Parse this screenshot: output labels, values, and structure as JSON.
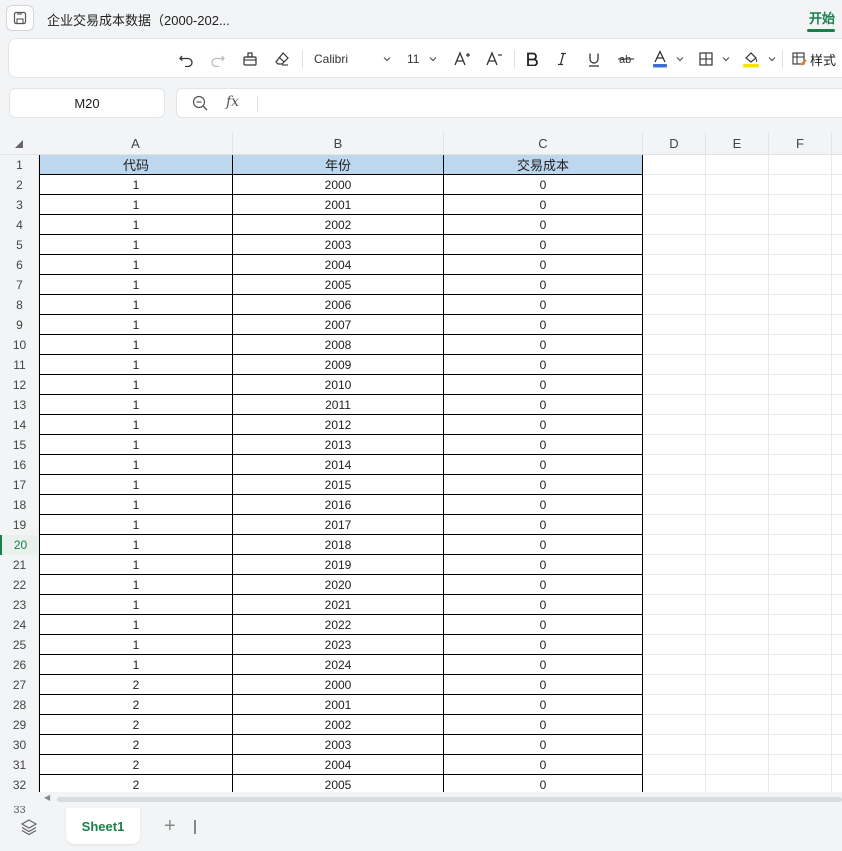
{
  "app": {
    "doc_title": "企业交易成本数据（2000-202...",
    "tab_active": "开始"
  },
  "toolbar": {
    "font_name": "Calibri",
    "font_size": "11",
    "style_label": "样式",
    "font_color": "#3b6fd8",
    "fill_color": "#f5e400",
    "icons": [
      "undo-icon",
      "redo-icon",
      "format-painter-icon",
      "clear-icon",
      "increase-font-icon",
      "decrease-font-icon",
      "bold-icon",
      "italic-icon",
      "underline-icon",
      "strikethrough-icon",
      "font-color-icon",
      "border-icon",
      "fill-color-icon",
      "styles-icon"
    ]
  },
  "formula": {
    "cell_ref": "M20",
    "fx_label": "fx",
    "value": ""
  },
  "grid": {
    "columns": [
      "A",
      "B",
      "C",
      "D",
      "E",
      "F"
    ],
    "active_row": 20,
    "header_fill": "#bdd7ee",
    "header": [
      "代码",
      "年份",
      "交易成本"
    ],
    "rows": [
      [
        "1",
        "2000",
        "0"
      ],
      [
        "1",
        "2001",
        "0"
      ],
      [
        "1",
        "2002",
        "0"
      ],
      [
        "1",
        "2003",
        "0"
      ],
      [
        "1",
        "2004",
        "0"
      ],
      [
        "1",
        "2005",
        "0"
      ],
      [
        "1",
        "2006",
        "0"
      ],
      [
        "1",
        "2007",
        "0"
      ],
      [
        "1",
        "2008",
        "0"
      ],
      [
        "1",
        "2009",
        "0"
      ],
      [
        "1",
        "2010",
        "0"
      ],
      [
        "1",
        "2011",
        "0"
      ],
      [
        "1",
        "2012",
        "0"
      ],
      [
        "1",
        "2013",
        "0"
      ],
      [
        "1",
        "2014",
        "0"
      ],
      [
        "1",
        "2015",
        "0"
      ],
      [
        "1",
        "2016",
        "0"
      ],
      [
        "1",
        "2017",
        "0"
      ],
      [
        "1",
        "2018",
        "0"
      ],
      [
        "1",
        "2019",
        "0"
      ],
      [
        "1",
        "2020",
        "0"
      ],
      [
        "1",
        "2021",
        "0"
      ],
      [
        "1",
        "2022",
        "0"
      ],
      [
        "1",
        "2023",
        "0"
      ],
      [
        "1",
        "2024",
        "0"
      ],
      [
        "2",
        "2000",
        "0"
      ],
      [
        "2",
        "2001",
        "0"
      ],
      [
        "2",
        "2002",
        "0"
      ],
      [
        "2",
        "2003",
        "0"
      ],
      [
        "2",
        "2004",
        "0"
      ],
      [
        "2",
        "2005",
        "0"
      ]
    ],
    "row_numbers": [
      "1",
      "2",
      "3",
      "4",
      "5",
      "6",
      "7",
      "8",
      "9",
      "10",
      "11",
      "12",
      "13",
      "14",
      "15",
      "16",
      "17",
      "18",
      "19",
      "20",
      "21",
      "22",
      "23",
      "24",
      "25",
      "26",
      "27",
      "28",
      "29",
      "30",
      "31",
      "32"
    ],
    "partial_row": "33"
  },
  "sheets": {
    "tabs": [
      "Sheet1"
    ],
    "add_label": "+"
  }
}
